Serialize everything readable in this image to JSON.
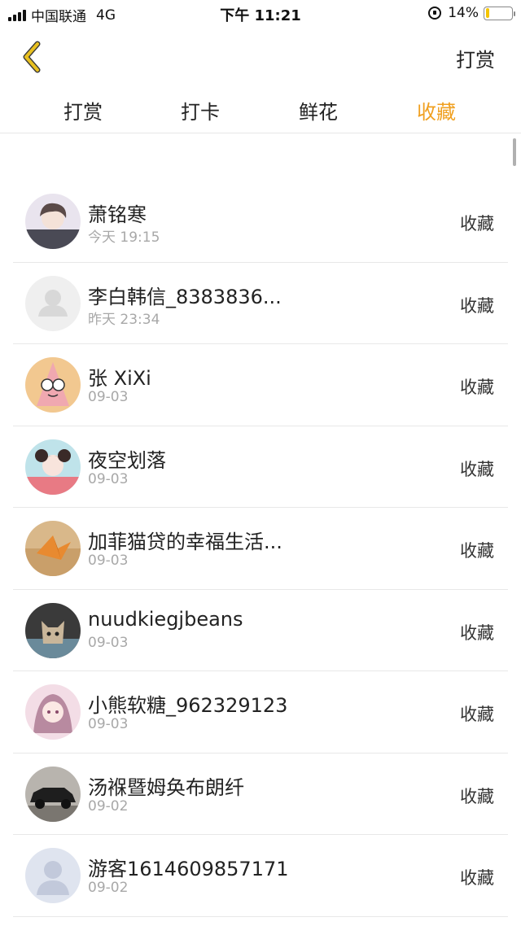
{
  "status_bar": {
    "carrier": "中国联通",
    "network": "4G",
    "time": "下午 11:21",
    "battery": "14%",
    "battery_level": 0.14
  },
  "nav": {
    "back_icon": "chevron-left-icon",
    "action_label": "打赏"
  },
  "tabs": [
    {
      "label": "打赏",
      "active": false
    },
    {
      "label": "打卡",
      "active": false
    },
    {
      "label": "鲜花",
      "active": false
    },
    {
      "label": "收藏",
      "active": true
    }
  ],
  "colors": {
    "accent": "#f0a020",
    "back_icon": "#e0b800"
  },
  "list": [
    {
      "name": "萧铭寒",
      "time": "今天 19:15",
      "action": "收藏",
      "avatar": "anime-boy"
    },
    {
      "name": "李白韩信_8383836...",
      "time": "昨天 23:34",
      "action": "收藏",
      "avatar": "default"
    },
    {
      "name": "张 XiXi",
      "time": "09-03",
      "action": "收藏",
      "avatar": "patrick-star"
    },
    {
      "name": "夜空划落",
      "time": "09-03",
      "action": "收藏",
      "avatar": "anime-girl"
    },
    {
      "name": "加菲猫贷的幸福生活...",
      "time": "09-03",
      "action": "收藏",
      "avatar": "paper-crane"
    },
    {
      "name": "nuudkiegjbeans",
      "time": "09-03",
      "action": "收藏",
      "avatar": "kitten"
    },
    {
      "name": "小熊软糖_962329123",
      "time": "09-03",
      "action": "收藏",
      "avatar": "anime-girl-pink"
    },
    {
      "name": "汤褓暨姆奂布朗纤",
      "time": "09-02",
      "action": "收藏",
      "avatar": "vintage-car"
    },
    {
      "name": "游客1614609857171",
      "time": "09-02",
      "action": "收藏",
      "avatar": "guest"
    }
  ]
}
